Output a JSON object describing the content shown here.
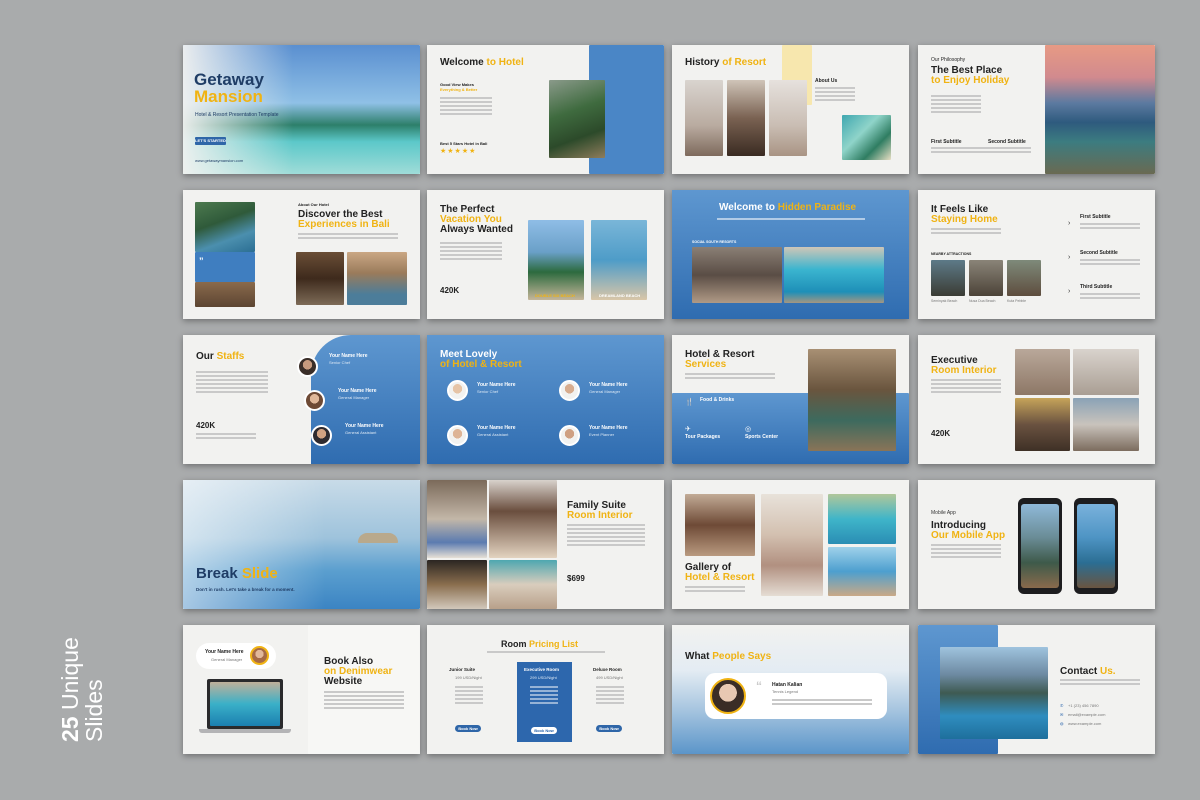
{
  "colors": {
    "background": "#a9abac",
    "slide": "#f2f2f0",
    "blue": "#3f7ec0",
    "yellow": "#f0b313"
  },
  "caption": {
    "num": "25",
    "word1": "Unique",
    "word2": "Slides"
  },
  "slides": {
    "s1": {
      "t1": "Getaway",
      "t2": "Mansion",
      "sub": "Hotel & Resort Presentation Template",
      "btn": "LET'S STARTED",
      "url": "www.getawaymansion.com"
    },
    "s2": {
      "t1": "Welcome",
      "t2": "to Hotel",
      "k1": "Good View Makes",
      "k2": "Everything & Better",
      "stars_label": "Best 5 Stars Hotel in Bali",
      "stars": "★★★★★"
    },
    "s3": {
      "t1": "History",
      "t2": "of Resort",
      "about": "About Us"
    },
    "s4": {
      "kicker": "Our Philosophy",
      "t1": "The Best Place",
      "t2": "to Enjoy Holiday",
      "f1": "First Subtitle",
      "f2": "Second Subtitle"
    },
    "s5": {
      "kicker": "About Our Hotel",
      "t1": "Discover the Best",
      "t2": "Experiences in Bali",
      "quote": "”"
    },
    "s6": {
      "t1": "The Perfect",
      "t2": "Vacation You",
      "t3": "Always Wanted",
      "stat": "420K",
      "c1": "DOUBLE SIX BEACH",
      "c2": "DREAMLAND BEACH"
    },
    "s7": {
      "t1": "Welcome to",
      "t2": "Hidden Paradise",
      "label": "SOCIAL SOUTH RESORTS"
    },
    "s8": {
      "t1": "It Feels Like",
      "t2": "Staying Home",
      "near": "NEARBY ATTRACTIONS",
      "f1": "First Subtitle",
      "f2": "Second Subtitle",
      "f3": "Third Subtitle",
      "p1": "Seminyak Beach",
      "p2": "Nusa Dua Beach",
      "p3": "Kuta Pebble"
    },
    "s9": {
      "t1": "Our",
      "t2": "Staffs",
      "stat": "420K",
      "n1": "Your Name Here",
      "r1": "Senior Chef",
      "n2": "Your Name Here",
      "r2": "General Manager",
      "n3": "Your Name Here",
      "r3": "General Assistant"
    },
    "s10": {
      "t1": "Meet Lovely",
      "t2": "of Hotel & Resort",
      "n1": "Your Name Here",
      "r1": "Senior Chef",
      "n2": "Your Name Here",
      "r2": "General Manager",
      "n3": "Your Name Here",
      "r3": "General Assistant",
      "n4": "Your Name Here",
      "r4": "Event Planner"
    },
    "s11": {
      "t1": "Hotel & Resort",
      "t2": "Services",
      "sv1": "Food & Drinks",
      "sv2": "Tour Packages",
      "sv3": "Sports Center"
    },
    "s12": {
      "t1": "Executive",
      "t2": "Room Interior",
      "stat": "420K"
    },
    "s13": {
      "t1": "Break",
      "t2": "Slide",
      "sub": "Don't in rush. Let's take a break for a moment."
    },
    "s14": {
      "t1": "Family Suite",
      "t2": "Room Interior",
      "price": "$699"
    },
    "s15": {
      "t1": "Gallery of",
      "t2": "Hotel & Resort"
    },
    "s16": {
      "kicker": "Mobile App",
      "t1": "Introducing",
      "t2": "Our Mobile App"
    },
    "s17": {
      "name": "Your Name Here",
      "role": "General Manager",
      "t1": "Book Also",
      "t2": "on Denimwear",
      "t3": "Website"
    },
    "s18": {
      "t1": "Room",
      "t2": "Pricing List",
      "c1": "Junior Suite",
      "p1": "199 USD/Night",
      "c2": "Executive Room",
      "p2": "299 USD/Night",
      "c3": "Deluxe Room",
      "p3": "499 USD/Night",
      "b1": "Book Now",
      "b2": "Book Now",
      "b3": "Book Now"
    },
    "s19": {
      "t1": "What",
      "t2": "People Says",
      "name": "Hatan Kalian",
      "role": "Tennis Legend",
      "quote": "“"
    },
    "s20": {
      "t1": "Contact",
      "t2": "Us.",
      "phone": "+1 (23) 456 7890",
      "email": "email@example.com",
      "web": "www.example.com"
    }
  },
  "icons": [
    "arrow-right-icon",
    "star-icon",
    "phone-icon",
    "mail-icon",
    "globe-icon",
    "quote-icon",
    "food-icon",
    "plane-icon",
    "sports-icon"
  ]
}
